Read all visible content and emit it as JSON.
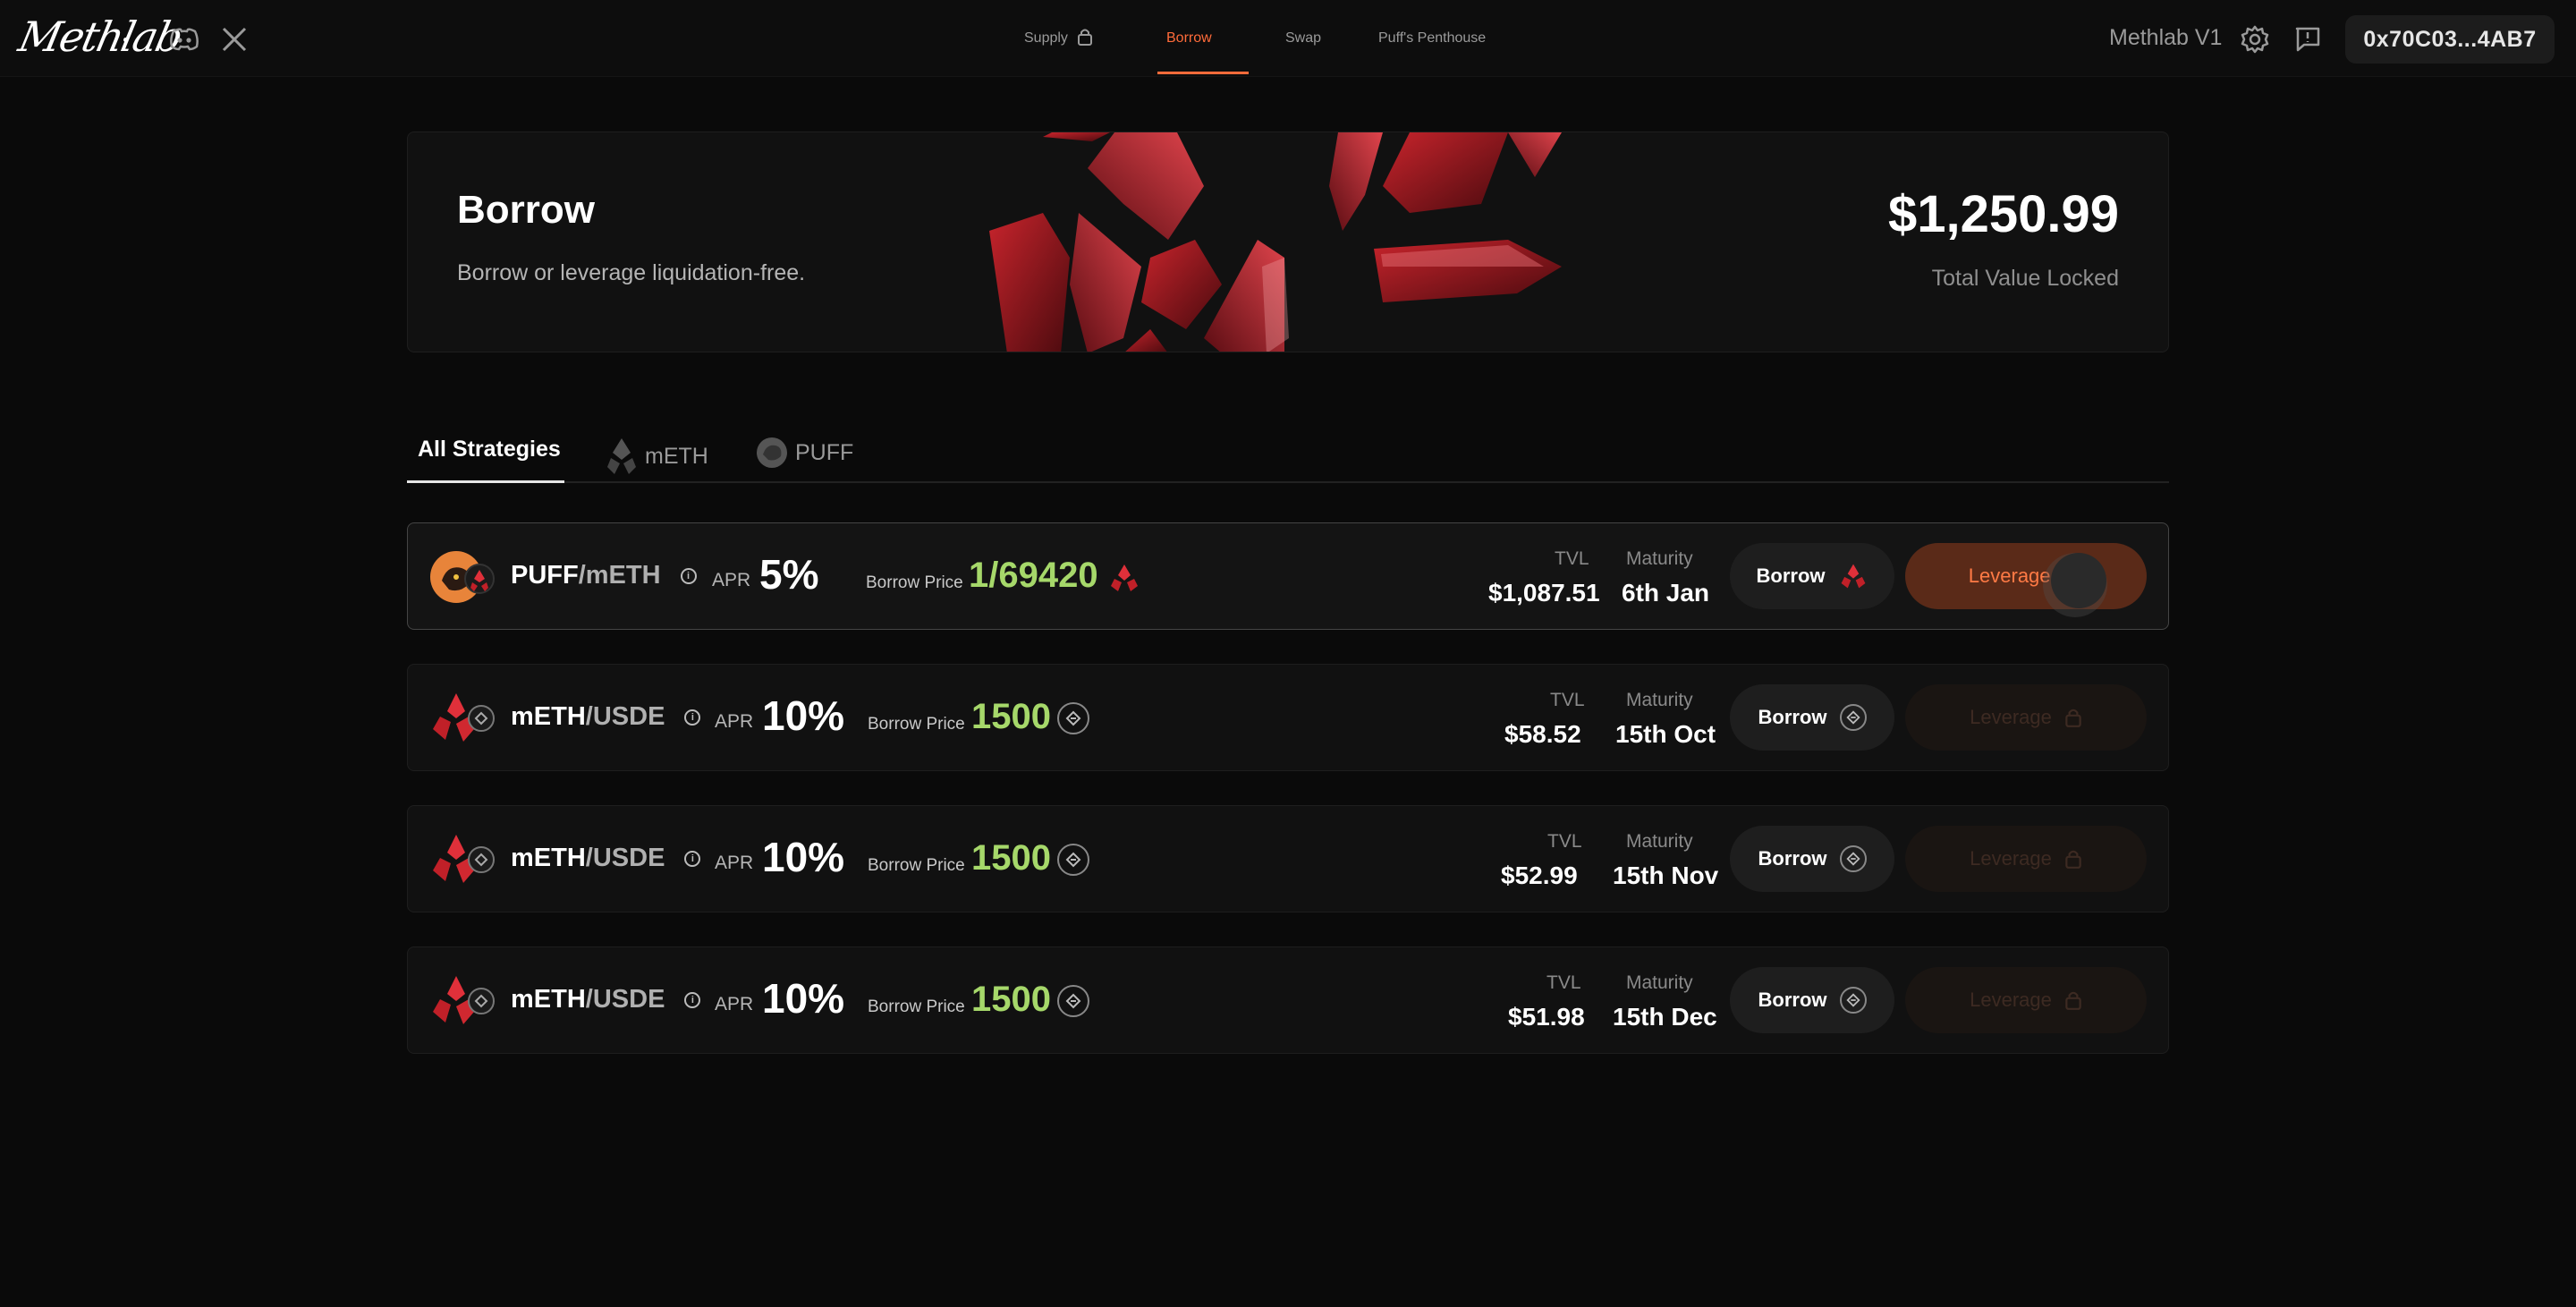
{
  "header": {
    "nav": [
      {
        "label": "Supply",
        "locked": true
      },
      {
        "label": "Borrow",
        "active": true
      },
      {
        "label": "Swap"
      },
      {
        "label": "Puff's Penthouse"
      }
    ],
    "version": "Methlab V1",
    "wallet": "0x70C03...4AB7"
  },
  "hero": {
    "title": "Borrow",
    "subtitle": "Borrow or leverage liquidation-free.",
    "tvl_amount": "$1,250.99",
    "tvl_label": "Total Value Locked"
  },
  "tabs": [
    "All Strategies",
    "mETH",
    "PUFF"
  ],
  "rows": [
    {
      "base": "PUFF",
      "quote": "/mETH",
      "apr_label": "APR",
      "apr": "5%",
      "borrow_price_label": "Borrow Price",
      "borrow_price": "1/69420",
      "tvl_label": "TVL",
      "tvl": "$1,087.51",
      "maturity_label": "Maturity",
      "maturity": "6th Jan",
      "borrow_label": "Borrow",
      "leverage_label": "Leverage 2.6",
      "leverage_enabled": true
    },
    {
      "base": "mETH",
      "quote": "/USDE",
      "apr_label": "APR",
      "apr": "10%",
      "borrow_price_label": "Borrow Price",
      "borrow_price": "1500",
      "tvl_label": "TVL",
      "tvl": "$58.52",
      "maturity_label": "Maturity",
      "maturity": "15th Oct",
      "borrow_label": "Borrow",
      "leverage_label": "Leverage",
      "leverage_enabled": false
    },
    {
      "base": "mETH",
      "quote": "/USDE",
      "apr_label": "APR",
      "apr": "10%",
      "borrow_price_label": "Borrow Price",
      "borrow_price": "1500",
      "tvl_label": "TVL",
      "tvl": "$52.99",
      "maturity_label": "Maturity",
      "maturity": "15th Nov",
      "borrow_label": "Borrow",
      "leverage_label": "Leverage",
      "leverage_enabled": false
    },
    {
      "base": "mETH",
      "quote": "/USDE",
      "apr_label": "APR",
      "apr": "10%",
      "borrow_price_label": "Borrow Price",
      "borrow_price": "1500",
      "tvl_label": "TVL",
      "tvl": "$51.98",
      "maturity_label": "Maturity",
      "maturity": "15th Dec",
      "borrow_label": "Borrow",
      "leverage_label": "Leverage",
      "leverage_enabled": false
    }
  ],
  "colors": {
    "accent": "#ff6b3a",
    "price_green": "#a6d86a",
    "background": "#0a0a0a"
  },
  "icons": [
    "discord-icon",
    "x-icon",
    "lock-icon",
    "gear-icon",
    "feedback-icon",
    "info-icon",
    "meth-icon",
    "puff-icon",
    "usde-icon"
  ]
}
